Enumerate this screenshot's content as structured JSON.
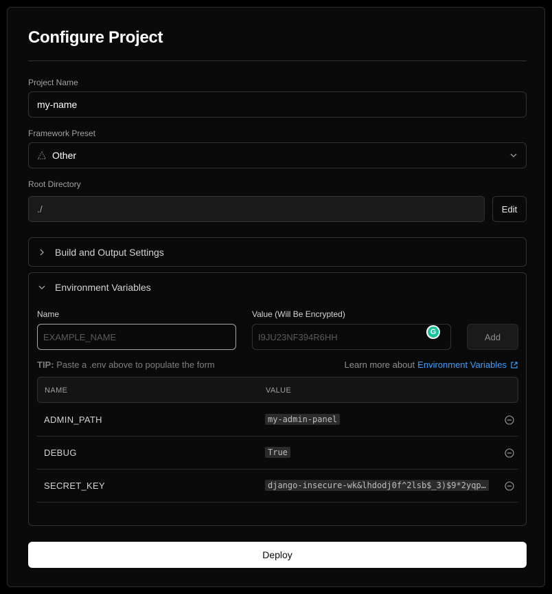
{
  "page": {
    "title": "Configure Project"
  },
  "project_name": {
    "label": "Project Name",
    "value": "my-name"
  },
  "framework": {
    "label": "Framework Preset",
    "value": "Other",
    "icon": "triangle-dotted-icon"
  },
  "root_dir": {
    "label": "Root Directory",
    "value": "./",
    "edit_label": "Edit"
  },
  "build": {
    "label": "Build and Output Settings",
    "expanded": false
  },
  "env": {
    "label": "Environment Variables",
    "expanded": true,
    "name_label": "Name",
    "value_label": "Value (Will Be Encrypted)",
    "name_placeholder": "EXAMPLE_NAME",
    "value_placeholder": "I9JU23NF394R6HH",
    "add_label": "Add",
    "grammarly_letter": "G",
    "tip_prefix": "TIP:",
    "tip_text": "Paste a .env above to populate the form",
    "learn_text": "Learn more about",
    "learn_link": "Environment Variables",
    "col_name": "NAME",
    "col_value": "VALUE",
    "rows": [
      {
        "name": "ADMIN_PATH",
        "value": "my-admin-panel"
      },
      {
        "name": "DEBUG",
        "value": "True"
      },
      {
        "name": "SECRET_KEY",
        "value": "django-insecure-wk&lhdodj0f^2lsb$_3)$9*2yqp…"
      }
    ]
  },
  "deploy_label": "Deploy",
  "colors": {
    "accent_link": "#3b9eff",
    "grammarly": "#15c39a",
    "background": "#0a0a0a"
  }
}
